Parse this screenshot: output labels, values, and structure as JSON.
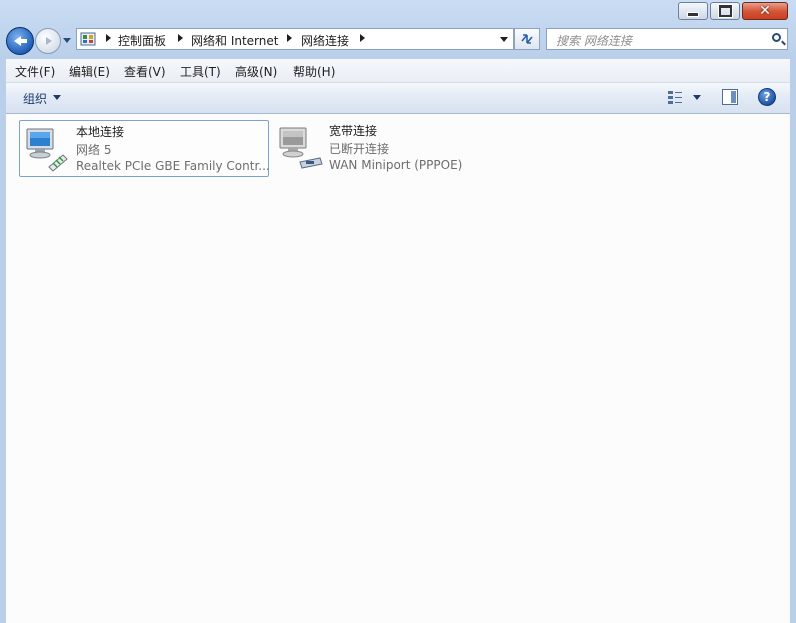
{
  "window": {
    "min_glyph": "minimize-icon",
    "max_glyph": "maximize-icon",
    "close_glyph": "✕"
  },
  "address": {
    "crumbs": [
      "控制面板",
      "网络和 Internet",
      "网络连接"
    ]
  },
  "search": {
    "placeholder": "搜索 网络连接"
  },
  "menu": {
    "items": [
      "文件(F)",
      "编辑(E)",
      "查看(V)",
      "工具(T)",
      "高级(N)",
      "帮助(H)"
    ]
  },
  "toolbar": {
    "organize": "组织",
    "help": "?"
  },
  "connections": [
    {
      "name": "本地连接",
      "status": "网络  5",
      "device": "Realtek PCIe GBE Family Contr...",
      "icon": "lan-connection-icon",
      "selected": true
    },
    {
      "name": "宽带连接",
      "status": "已断开连接",
      "device": "WAN Miniport (PPPOE)",
      "icon": "broadband-connection-icon",
      "selected": false
    }
  ],
  "colors": {
    "frame": "#b9cfea",
    "close_button": "#c7401f",
    "selection_border": "#7da2ce"
  }
}
